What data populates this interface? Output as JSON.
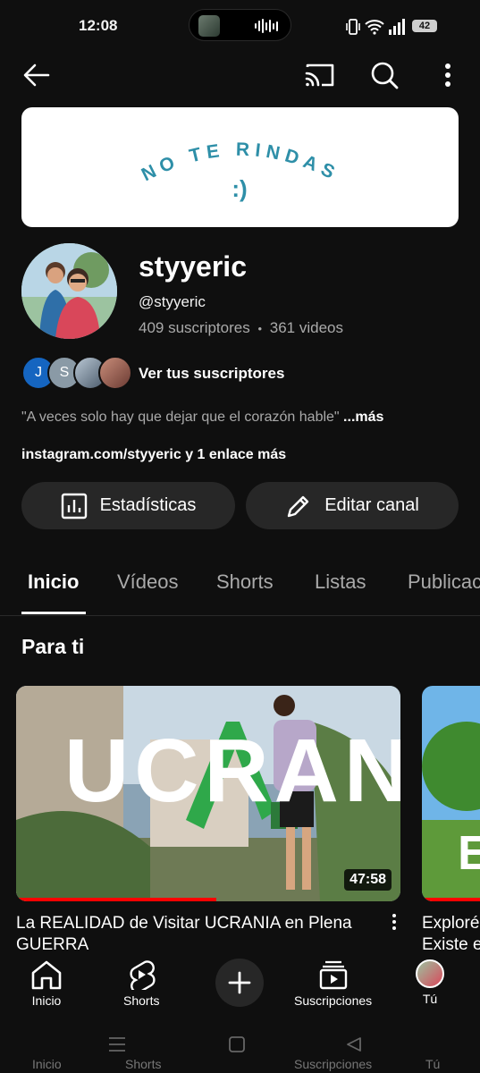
{
  "status_bar": {
    "time": "12:08",
    "battery": "42"
  },
  "app_bar": {
    "back_icon": "arrow-left-icon",
    "cast_icon": "cast-icon",
    "search_icon": "search-icon",
    "menu_icon": "more-vertical-icon"
  },
  "banner": {
    "line1": "NO TE RINDAS",
    "line2": ":)"
  },
  "channel": {
    "name": "styyeric",
    "handle": "@styyeric",
    "subscribers": "409 suscriptores",
    "separator": "•",
    "videos": "361 videos",
    "subscriber_initials": [
      "J",
      "S"
    ],
    "view_subscribers": "Ver tus suscriptores",
    "description": "\"A veces solo hay que dejar que el corazón hable\"",
    "more": "...más",
    "links": "instagram.com/styyeric y 1 enlace más"
  },
  "actions": {
    "stats": "Estadísticas",
    "edit": "Editar canal"
  },
  "tabs": [
    "Inicio",
    "Vídeos",
    "Shorts",
    "Listas",
    "Publicaciones"
  ],
  "section": {
    "title": "Para ti"
  },
  "videos": [
    {
      "title": "La REALIDAD de Visitar UCRANIA en Plena GUERRA",
      "duration": "47:58",
      "thumb_text": "UCRANIA",
      "progress": 0.52
    },
    {
      "title": "Exploré\nExiste e",
      "thumb_text": "ES",
      "progress": 1.0
    }
  ],
  "bottom_nav": {
    "home": "Inicio",
    "shorts": "Shorts",
    "subscriptions": "Suscripciones",
    "you": "Tú"
  },
  "ghost_labels": [
    "Inicio",
    "Shorts",
    "Suscripciones",
    "Tú"
  ],
  "colors": {
    "background": "#0f0f0f",
    "chip": "#272727",
    "accent": "#ff0000",
    "banner_text": "#2e8fa8"
  }
}
